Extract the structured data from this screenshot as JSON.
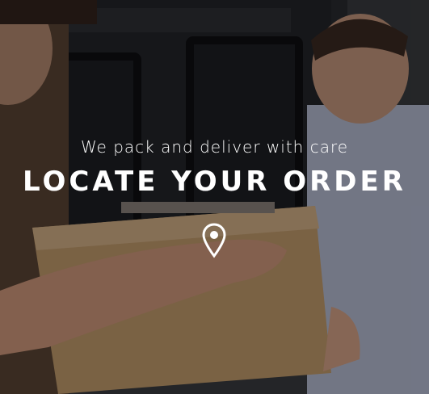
{
  "hero": {
    "subtitle": "We pack and deliver with care",
    "title": "LOCATE YOUR ORDER",
    "icon": "map-pin-icon",
    "colors": {
      "text": "#ffffff",
      "overlay": "rgba(0,0,0,0.38)"
    }
  }
}
